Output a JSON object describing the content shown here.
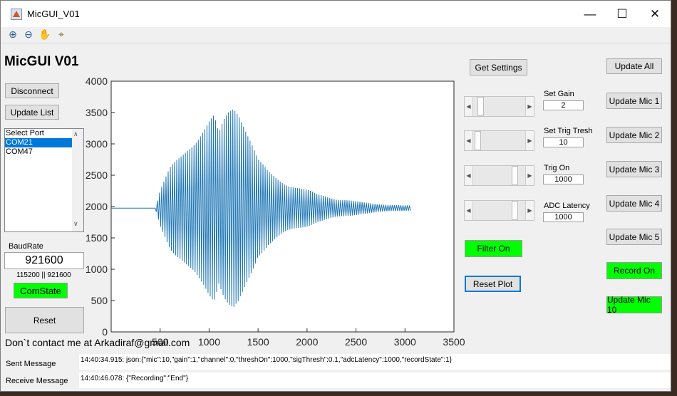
{
  "window": {
    "title": "MicGUI_V01"
  },
  "toolbar_icons": [
    "zoom-in-icon",
    "zoom-out-icon",
    "pan-hand-icon",
    "data-cursor-icon"
  ],
  "app": {
    "heading": "MicGUI V01"
  },
  "connection": {
    "disconnect_label": "Disconnect",
    "update_list_label": "Update List",
    "ports": [
      "Select Port",
      "COM21",
      "COM47"
    ],
    "selected_port": "COM21",
    "baud_label": "BaudRate",
    "baud_value": "921600",
    "baud_options": "115200 || 921600",
    "comstate_label": "ComState",
    "reset_label": "Reset"
  },
  "footer_text": "Don`t contact me at Arkadiraf@gmail.com",
  "controls": {
    "get_settings_label": "Get Settings",
    "set_gain_label": "Set Gain",
    "set_gain_value": "2",
    "set_trig_label": "Set Trig Tresh",
    "set_trig_value": "10",
    "trig_on_label": "Trig On",
    "trig_on_value": "1000",
    "adc_label": "ADC Latency",
    "adc_value": "1000",
    "filter_label": "Filter On",
    "reset_plot_label": "Reset Plot"
  },
  "update_buttons": {
    "update_all": "Update All",
    "mic1": "Update Mic 1",
    "mic2": "Update Mic 2",
    "mic3": "Update Mic 3",
    "mic4": "Update Mic 4",
    "mic5": "Update Mic 5",
    "record_on": "Record On",
    "mic10": "Update Mic 10"
  },
  "messages": {
    "sent_label": "Sent Message",
    "sent_text": "14:40:34.915:  json:{\"mic\":10,\"gain\":1,\"channel\":0,\"threshOn\":1000,\"sigThresh\":0.1,\"adcLatency\":1000,\"recordState\":1}",
    "receive_label": "Receive Message",
    "receive_text": "14:40:46.078:  {\"Recording\":\"End\"}"
  },
  "colors": {
    "green_button": "#00ff00",
    "signal_line": "#1f77b4",
    "selection": "#0078d7"
  },
  "chart_data": {
    "type": "line",
    "title": "",
    "xlabel": "",
    "ylabel": "",
    "xlim": [
      0,
      3500
    ],
    "ylim": [
      0,
      4000
    ],
    "xticks": [
      "500",
      "1000",
      "1500",
      "2000",
      "2500",
      "3000",
      "3500"
    ],
    "yticks": [
      "0",
      "500",
      "1000",
      "1500",
      "2000",
      "2500",
      "3000",
      "3500",
      "4000"
    ],
    "grid": false,
    "series": [
      {
        "baseline": 1975,
        "x_start": 0,
        "x_end": 3060,
        "signal_x_start": 450,
        "cycle_length": 22,
        "envelope": [
          [
            450,
            0
          ],
          [
            500,
            300
          ],
          [
            600,
            650
          ],
          [
            700,
            850
          ],
          [
            800,
            1100
          ],
          [
            900,
            1300
          ],
          [
            1000,
            1450
          ],
          [
            1050,
            1500
          ],
          [
            1100,
            1200
          ],
          [
            1150,
            1450
          ],
          [
            1200,
            1650
          ],
          [
            1250,
            1800
          ],
          [
            1300,
            1750
          ],
          [
            1350,
            1550
          ],
          [
            1400,
            1300
          ],
          [
            1450,
            1050
          ],
          [
            1500,
            800
          ],
          [
            1600,
            600
          ],
          [
            1700,
            500
          ],
          [
            1800,
            420
          ],
          [
            1900,
            360
          ],
          [
            2000,
            300
          ],
          [
            2100,
            230
          ],
          [
            2200,
            200
          ],
          [
            2300,
            160
          ],
          [
            2400,
            140
          ],
          [
            2500,
            110
          ],
          [
            2600,
            90
          ],
          [
            2700,
            75
          ],
          [
            2800,
            60
          ],
          [
            2900,
            50
          ],
          [
            3060,
            40
          ]
        ]
      }
    ]
  }
}
